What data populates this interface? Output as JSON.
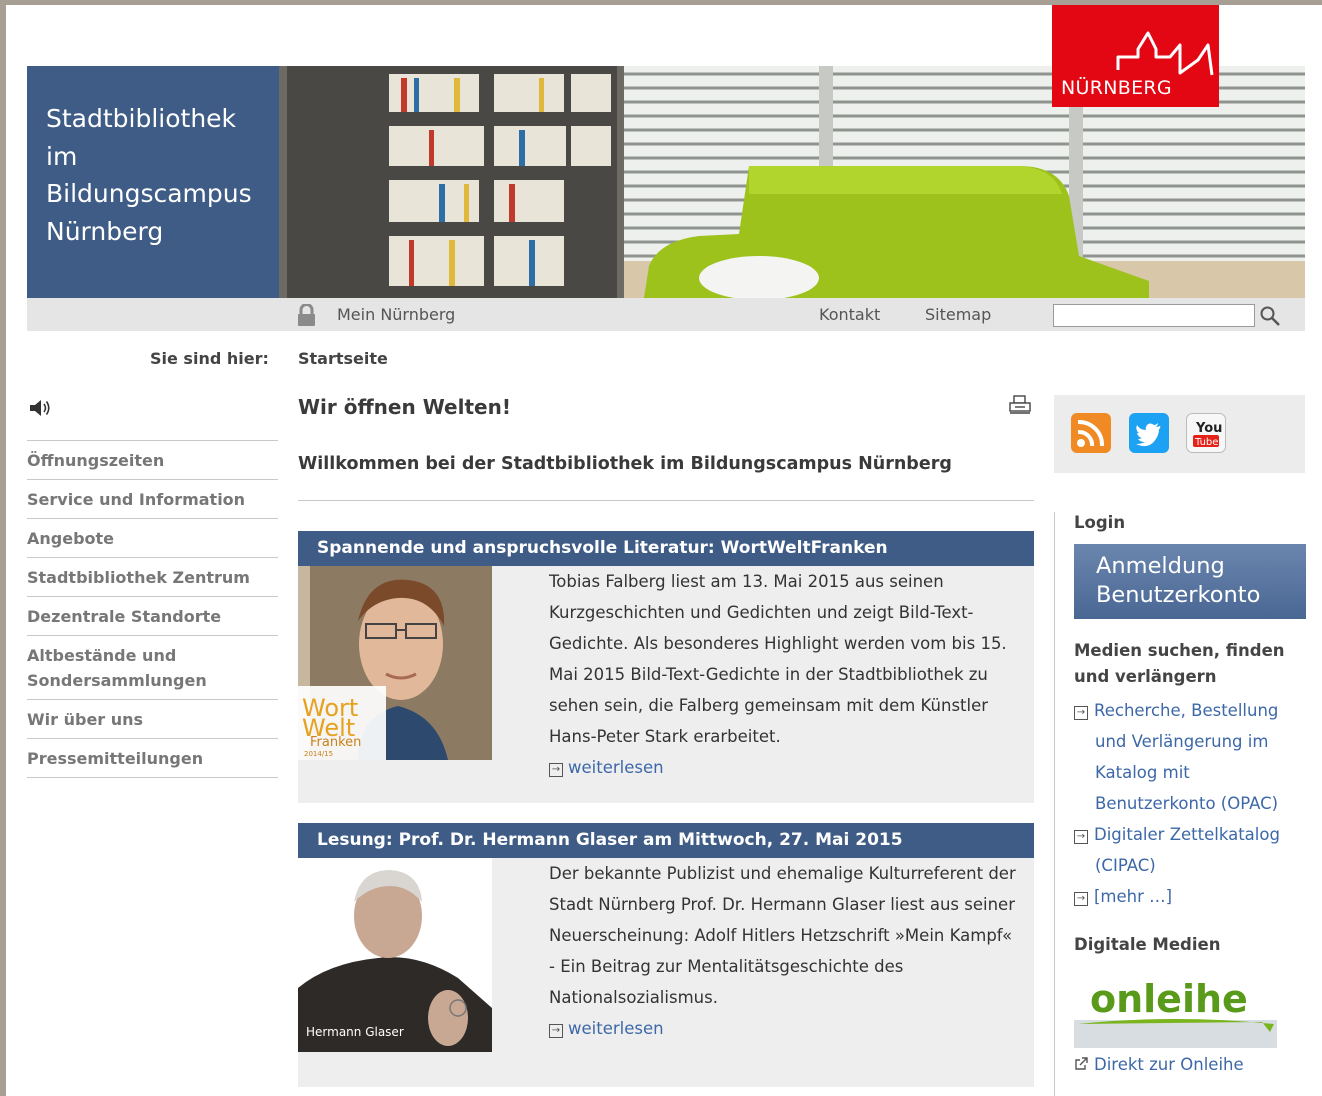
{
  "header": {
    "title_lines": [
      "Stadtbibliothek",
      "im",
      "Bildungscampus",
      "Nürnberg"
    ],
    "logo_text": "NÜRNBERG",
    "colors": {
      "brand_blue": "#3f5c86",
      "city_red": "#e30613",
      "link_blue": "#3d68a8"
    }
  },
  "topnav": {
    "lock_icon": "lock-icon",
    "mein": "Mein Nürnberg",
    "kontakt": "Kontakt",
    "sitemap": "Sitemap",
    "search_value": "",
    "search_icon": "magnifier-icon"
  },
  "breadcrumb": {
    "label": "Sie sind hier:",
    "current": "Startseite"
  },
  "leftnav": {
    "speaker_icon": "speaker-icon",
    "items": [
      "Öffnungszeiten",
      "Service und Information",
      "Angebote",
      "Stadtbibliothek Zentrum",
      "Dezentrale Standorte",
      "Altbestände und Sondersammlungen",
      "Wir über uns",
      "Pressemitteilungen"
    ]
  },
  "main": {
    "heading": "Wir öffnen Welten!",
    "subheading": "Willkommen bei der Stadtbibliothek im Bildungscampus Nürnberg",
    "teasers": [
      {
        "title": "Spannende und anspruchsvolle Literatur: WortWeltFranken",
        "text": "Tobias Falberg liest am 13. Mai 2015 aus seinen Kurzgeschichten und Gedichten und zeigt Bild-Text-Gedichte. Als besonderes Highlight werden vom bis 15. Mai 2015 Bild-Text-Gedichte in der Stadtbibliothek zu sehen sein, die Falberg gemeinsam mit dem Künstler Hans-Peter Stark erarbeitet.",
        "more": "weiterlesen",
        "image_logo": [
          "Wort",
          "Welt",
          "Franken",
          "2014/15"
        ]
      },
      {
        "title": "Lesung: Prof. Dr. Hermann Glaser am Mittwoch, 27. Mai 2015",
        "text": "Der bekannte Publizist und ehemalige Kulturreferent der Stadt Nürnberg Prof. Dr. Hermann Glaser liest aus seiner Neuerscheinung: Adolf Hitlers Hetzschrift »Mein Kampf« - Ein Beitrag zur Mentalitätsgeschichte des Nationalsozialismus.",
        "more": "weiterlesen",
        "image_caption": "Hermann Glaser"
      }
    ]
  },
  "sidebar": {
    "social_icons": [
      "rss-icon",
      "twitter-icon",
      "youtube-icon"
    ],
    "youtube_text": [
      "You",
      "Tube"
    ],
    "login_label": "Login",
    "login_button": [
      "Anmeldung",
      "Benutzerkonto"
    ],
    "media_heading": [
      "Medien suchen, finden",
      "und verlängern"
    ],
    "links": [
      {
        "lines": [
          "Recherche, Bestellung",
          "und Verlängerung im",
          "Katalog mit",
          "Benutzerkonto (OPAC)"
        ]
      },
      {
        "lines": [
          "Digitaler Zettelkatalog",
          "(CIPAC)"
        ]
      },
      {
        "lines": [
          "[mehr …]"
        ]
      }
    ],
    "digital_heading": "Digitale Medien",
    "onleihe_logo": "onleihe",
    "onleihe_link": "Direkt zur Onleihe"
  }
}
